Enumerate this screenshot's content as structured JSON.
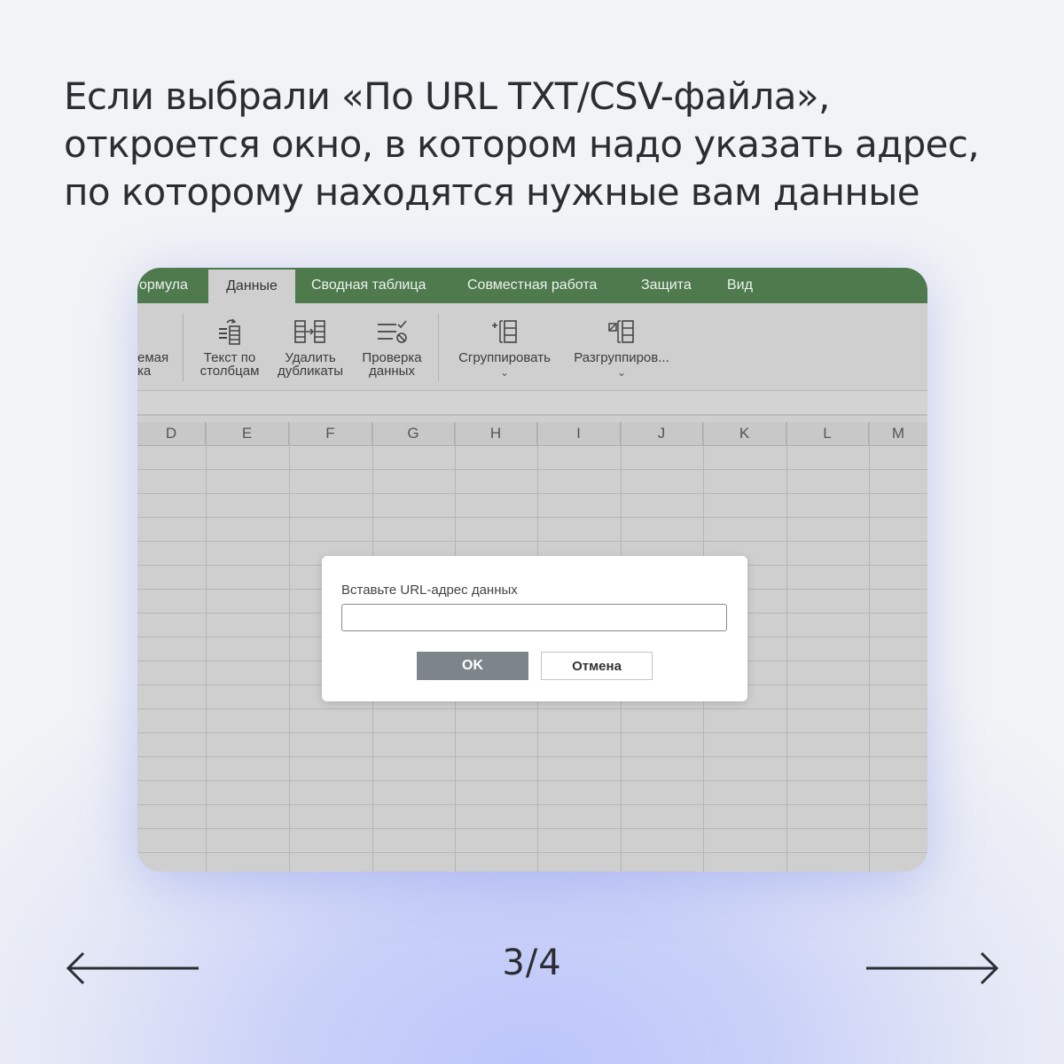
{
  "headline": {
    "line1": "Если выбрали «По URL TXT/CSV-файла»,",
    "line2": "откроется окно, в котором надо указать адрес,",
    "line3": "по которому находятся нужные вам данные"
  },
  "app": {
    "tabs": [
      {
        "label": "ормула"
      },
      {
        "label": "Данные",
        "active": true
      },
      {
        "label": "Сводная таблица"
      },
      {
        "label": "Совместная работа"
      },
      {
        "label": "Защита"
      },
      {
        "label": "Вид"
      }
    ],
    "ribbon": {
      "cut_label_line1": "емая",
      "cut_label_line2": "ка",
      "items": [
        {
          "line1": "Текст по",
          "line2": "столбцам",
          "icon": "text-to-columns-icon"
        },
        {
          "line1": "Удалить",
          "line2": "дубликаты",
          "icon": "remove-duplicates-icon"
        },
        {
          "line1": "Проверка",
          "line2": "данных",
          "icon": "data-validation-icon"
        },
        {
          "line1": "Сгруппировать",
          "icon": "group-icon"
        },
        {
          "line1": "Разгруппиров...",
          "icon": "ungroup-icon"
        }
      ],
      "chevron": "⌄"
    },
    "columns": [
      "D",
      "E",
      "F",
      "G",
      "H",
      "I",
      "J",
      "K",
      "L",
      "M"
    ],
    "accent_color": "#4e7a4e"
  },
  "dialog": {
    "label": "Вставьте URL-адрес данных",
    "input_value": "",
    "ok_label": "OK",
    "cancel_label": "Отмена"
  },
  "pager": {
    "text": "3/4"
  }
}
